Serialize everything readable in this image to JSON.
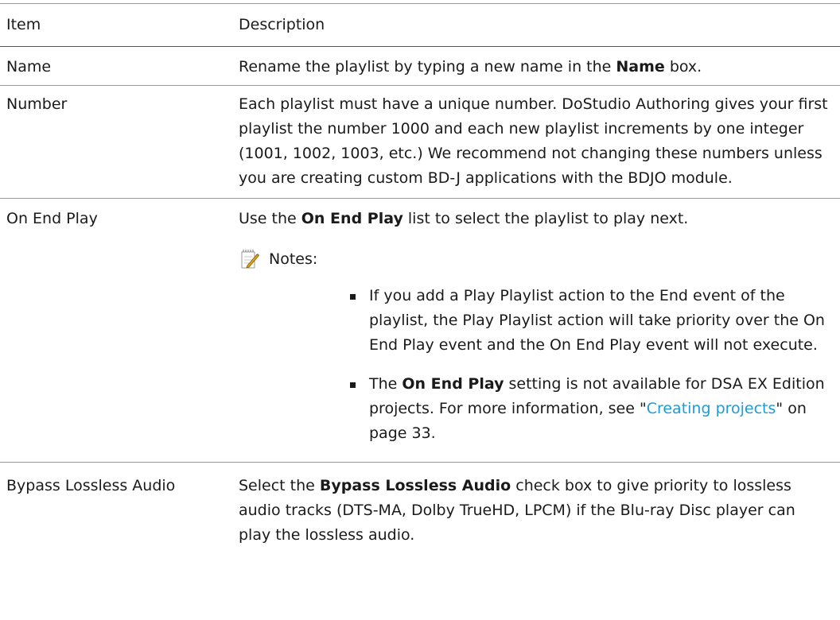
{
  "table": {
    "header": {
      "item": "Item",
      "description": "Description"
    },
    "rows": {
      "name": {
        "item": "Name",
        "d1": "Rename the playlist by typing a new name in the ",
        "d2": "Name",
        "d3": " box."
      },
      "number": {
        "item": "Number",
        "text": "Each playlist must have a unique number. DoStudio Authoring gives your first playlist the number 1000 and each new playlist increments by one integer (1001, 1002, 1003, etc.) We recommend not changing these numbers unless you are creating custom BD-J applications with the BDJO module."
      },
      "on_end_play": {
        "item": "On End Play",
        "d1": "Use the ",
        "d2": "On End Play",
        "d3": " list to select the playlist to play next.",
        "notes_label": "Notes:",
        "bullet1": "If you add a Play Playlist action to the End event of the playlist, the Play Playlist action will take priority over the On End Play event and the On End Play event will not execute.",
        "bullet2": {
          "t1": "The ",
          "t2": "On End Play",
          "t3": " setting is not available for DSA EX Edition projects. For more information, see \"",
          "link": "Creating projects",
          "t4": "\" on page 33."
        }
      },
      "bypass": {
        "item": "Bypass Lossless Audio",
        "d1": "Select the ",
        "d2": "Bypass Lossless Audio",
        "d3": " check box to give priority to lossless audio tracks (DTS-MA, Dolby TrueHD, LPCM) if the Blu-ray Disc player can play the lossless audio."
      }
    }
  },
  "colors": {
    "link": "#1e9bd7",
    "text": "#1a1a1a",
    "rule": "#9a9a9a"
  },
  "icons": {
    "note": "notepad-pencil-icon",
    "bullet": "square-bullet-icon"
  }
}
